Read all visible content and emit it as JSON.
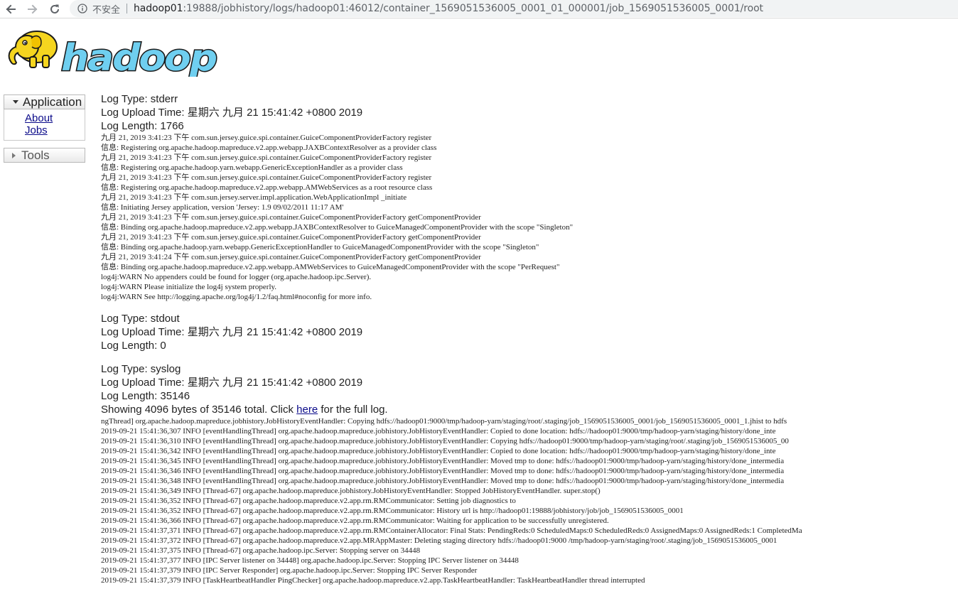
{
  "browser": {
    "insecure_label": "不安全",
    "url_host": "hadoop01",
    "url_rest": ":19888/jobhistory/logs/hadoop01:46012/container_1569051536005_0001_01_000001/job_1569051536005_0001/root"
  },
  "logo": {
    "text": "hadoop"
  },
  "sidebar": {
    "application": {
      "label": "Application",
      "links": [
        "About",
        "Jobs"
      ]
    },
    "tools": {
      "label": "Tools"
    }
  },
  "logs": [
    {
      "type_line": "Log Type: stderr",
      "upload_line": "Log Upload Time: 星期六 九月 21 15:41:42 +0800 2019",
      "length_line": "Log Length: 1766",
      "content": "九月 21, 2019 3:41:23 下午 com.sun.jersey.guice.spi.container.GuiceComponentProviderFactory register\n信息: Registering org.apache.hadoop.mapreduce.v2.app.webapp.JAXBContextResolver as a provider class\n九月 21, 2019 3:41:23 下午 com.sun.jersey.guice.spi.container.GuiceComponentProviderFactory register\n信息: Registering org.apache.hadoop.yarn.webapp.GenericExceptionHandler as a provider class\n九月 21, 2019 3:41:23 下午 com.sun.jersey.guice.spi.container.GuiceComponentProviderFactory register\n信息: Registering org.apache.hadoop.mapreduce.v2.app.webapp.AMWebServices as a root resource class\n九月 21, 2019 3:41:23 下午 com.sun.jersey.server.impl.application.WebApplicationImpl _initiate\n信息: Initiating Jersey application, version 'Jersey: 1.9 09/02/2011 11:17 AM'\n九月 21, 2019 3:41:23 下午 com.sun.jersey.guice.spi.container.GuiceComponentProviderFactory getComponentProvider\n信息: Binding org.apache.hadoop.mapreduce.v2.app.webapp.JAXBContextResolver to GuiceManagedComponentProvider with the scope \"Singleton\"\n九月 21, 2019 3:41:23 下午 com.sun.jersey.guice.spi.container.GuiceComponentProviderFactory getComponentProvider\n信息: Binding org.apache.hadoop.yarn.webapp.GenericExceptionHandler to GuiceManagedComponentProvider with the scope \"Singleton\"\n九月 21, 2019 3:41:24 下午 com.sun.jersey.guice.spi.container.GuiceComponentProviderFactory getComponentProvider\n信息: Binding org.apache.hadoop.mapreduce.v2.app.webapp.AMWebServices to GuiceManagedComponentProvider with the scope \"PerRequest\"\nlog4j:WARN No appenders could be found for logger (org.apache.hadoop.ipc.Server).\nlog4j:WARN Please initialize the log4j system properly.\nlog4j:WARN See http://logging.apache.org/log4j/1.2/faq.html#noconfig for more info."
    },
    {
      "type_line": "Log Type: stdout",
      "upload_line": "Log Upload Time: 星期六 九月 21 15:41:42 +0800 2019",
      "length_line": "Log Length: 0"
    },
    {
      "type_line": "Log Type: syslog",
      "upload_line": "Log Upload Time: 星期六 九月 21 15:41:42 +0800 2019",
      "length_line": "Log Length: 35146",
      "showing_prefix": "Showing 4096 bytes of 35146 total. Click ",
      "showing_link": "here",
      "showing_suffix": " for the full log.",
      "content": "ngThread] org.apache.hadoop.mapreduce.jobhistory.JobHistoryEventHandler: Copying hdfs://hadoop01:9000/tmp/hadoop-yarn/staging/root/.staging/job_1569051536005_0001/job_1569051536005_0001_1.jhist to hdfs\n2019-09-21 15:41:36,307 INFO [eventHandlingThread] org.apache.hadoop.mapreduce.jobhistory.JobHistoryEventHandler: Copied to done location: hdfs://hadoop01:9000/tmp/hadoop-yarn/staging/history/done_inte\n2019-09-21 15:41:36,310 INFO [eventHandlingThread] org.apache.hadoop.mapreduce.jobhistory.JobHistoryEventHandler: Copying hdfs://hadoop01:9000/tmp/hadoop-yarn/staging/root/.staging/job_1569051536005_00\n2019-09-21 15:41:36,342 INFO [eventHandlingThread] org.apache.hadoop.mapreduce.jobhistory.JobHistoryEventHandler: Copied to done location: hdfs://hadoop01:9000/tmp/hadoop-yarn/staging/history/done_inte\n2019-09-21 15:41:36,345 INFO [eventHandlingThread] org.apache.hadoop.mapreduce.jobhistory.JobHistoryEventHandler: Moved tmp to done: hdfs://hadoop01:9000/tmp/hadoop-yarn/staging/history/done_intermedia\n2019-09-21 15:41:36,346 INFO [eventHandlingThread] org.apache.hadoop.mapreduce.jobhistory.JobHistoryEventHandler: Moved tmp to done: hdfs://hadoop01:9000/tmp/hadoop-yarn/staging/history/done_intermedia\n2019-09-21 15:41:36,348 INFO [eventHandlingThread] org.apache.hadoop.mapreduce.jobhistory.JobHistoryEventHandler: Moved tmp to done: hdfs://hadoop01:9000/tmp/hadoop-yarn/staging/history/done_intermedia\n2019-09-21 15:41:36,349 INFO [Thread-67] org.apache.hadoop.mapreduce.jobhistory.JobHistoryEventHandler: Stopped JobHistoryEventHandler. super.stop()\n2019-09-21 15:41:36,352 INFO [Thread-67] org.apache.hadoop.mapreduce.v2.app.rm.RMCommunicator: Setting job diagnostics to\n2019-09-21 15:41:36,352 INFO [Thread-67] org.apache.hadoop.mapreduce.v2.app.rm.RMCommunicator: History url is http://hadoop01:19888/jobhistory/job/job_1569051536005_0001\n2019-09-21 15:41:36,366 INFO [Thread-67] org.apache.hadoop.mapreduce.v2.app.rm.RMCommunicator: Waiting for application to be successfully unregistered.\n2019-09-21 15:41:37,371 INFO [Thread-67] org.apache.hadoop.mapreduce.v2.app.rm.RMContainerAllocator: Final Stats: PendingReds:0 ScheduledMaps:0 ScheduledReds:0 AssignedMaps:0 AssignedReds:1 CompletedMa\n2019-09-21 15:41:37,372 INFO [Thread-67] org.apache.hadoop.mapreduce.v2.app.MRAppMaster: Deleting staging directory hdfs://hadoop01:9000 /tmp/hadoop-yarn/staging/root/.staging/job_1569051536005_0001\n2019-09-21 15:41:37,375 INFO [Thread-67] org.apache.hadoop.ipc.Server: Stopping server on 34448\n2019-09-21 15:41:37,377 INFO [IPC Server listener on 34448] org.apache.hadoop.ipc.Server: Stopping IPC Server listener on 34448\n2019-09-21 15:41:37,379 INFO [IPC Server Responder] org.apache.hadoop.ipc.Server: Stopping IPC Server Responder\n2019-09-21 15:41:37,379 INFO [TaskHeartbeatHandler PingChecker] org.apache.hadoop.mapreduce.v2.app.TaskHeartbeatHandler: TaskHeartbeatHandler thread interrupted"
    }
  ],
  "colors": {
    "link": "#0b0b8a",
    "logo_yellow": "#f5d51f",
    "logo_text_blue": "#6fcff0",
    "logo_outline": "#1a1a1a"
  },
  "icons": {
    "back": "arrow-left-icon",
    "forward": "arrow-right-icon",
    "reload": "reload-icon",
    "info": "info-icon",
    "expanded": "triangle-down-icon",
    "collapsed": "triangle-right-icon"
  }
}
